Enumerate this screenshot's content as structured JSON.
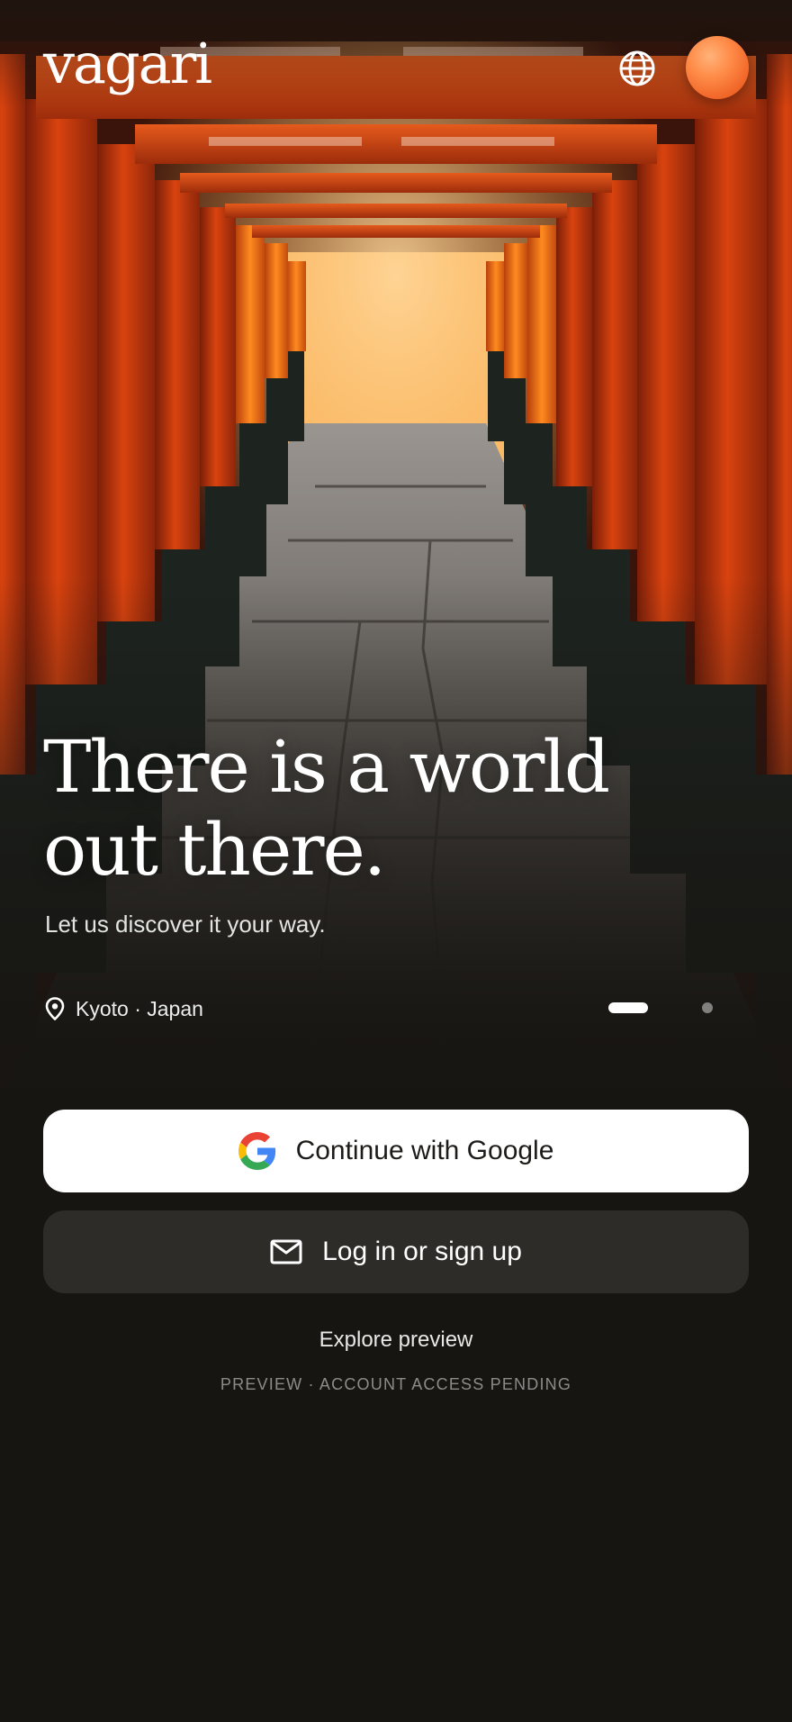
{
  "brand": {
    "logo_text": "vagari"
  },
  "header": {
    "language_icon": "globe-icon",
    "avatar_color": "#ff8a45"
  },
  "hero": {
    "headline_line1": "There is a world",
    "headline_line2": "out there.",
    "subheading": "Let us discover it your way.",
    "location_icon": "map-pin-icon",
    "location": "Kyoto · Japan",
    "carousel": {
      "active_index": 0,
      "total": 2
    }
  },
  "auth": {
    "google_button": "Continue with Google",
    "google_icon": "google-g-icon",
    "email_button": "Log in or sign up",
    "email_icon": "mail-icon",
    "explore_link": "Explore preview",
    "footnote": "PREVIEW · ACCOUNT ACCESS PENDING"
  },
  "colors": {
    "background": "#171512",
    "accent": "#f2692b",
    "primary_button": "#ffffff",
    "secondary_button": "#2e2c29"
  }
}
